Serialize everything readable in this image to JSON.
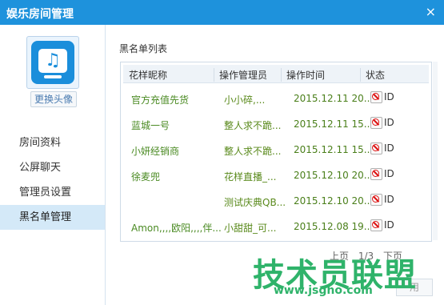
{
  "window": {
    "title": "娱乐房间管理",
    "close_label": "×"
  },
  "sidebar": {
    "change_avatar": "更换头像",
    "items": [
      {
        "label": "房间资料"
      },
      {
        "label": "公屏聊天"
      },
      {
        "label": "管理员设置"
      },
      {
        "label": "黑名单管理"
      }
    ]
  },
  "main": {
    "section_label": "黑名单列表",
    "columns": [
      "花样昵称",
      "操作管理员",
      "操作时间",
      "状态"
    ],
    "rows": [
      {
        "nick": "官方充值先货",
        "admin": "小小碎,...",
        "time": "2015.12.11 20...",
        "status": "ID"
      },
      {
        "nick": "蓝城一号",
        "admin": "整人求不跪...",
        "time": "2015.12.11 15...",
        "status": "ID"
      },
      {
        "nick": "小妍经销商",
        "admin": "整人求不跪...",
        "time": "2015.12.11 15...",
        "status": "ID"
      },
      {
        "nick": "徐麦兜",
        "admin": "花样直播_...",
        "time": "2015.12.10 20...",
        "status": "ID"
      },
      {
        "nick": "",
        "admin": "测试庆典QB...",
        "time": "2015.12.10 20...",
        "status": "ID"
      },
      {
        "nick": "Amon,,,,欧阳,,,,伴...",
        "admin": "小甜甜_可...",
        "time": "2015.12.08 19...",
        "status": "ID"
      }
    ],
    "pager": {
      "prev": "上页",
      "page": "1/3",
      "next": "下页"
    },
    "apply_button": "用"
  },
  "watermark": {
    "brand": "技术员联盟",
    "url": "www.jsgho.com"
  }
}
